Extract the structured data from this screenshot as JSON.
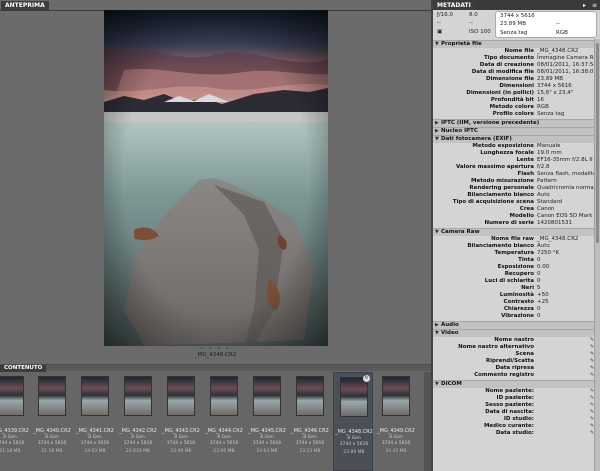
{
  "preview": {
    "tab": "ANTEPRIMA",
    "dots": "• • • •",
    "caption": "_MG_4348.CR2"
  },
  "content": {
    "tab": "CONTENUTO",
    "thumbnails": [
      {
        "name": "_MG_4339.CR2",
        "line2": "8 Gen",
        "line3": "3744 x 5616",
        "size": "21.18 MB",
        "selected": false
      },
      {
        "name": "_MG_4340.CR2",
        "line2": "8 Gen",
        "line3": "3744 x 5616",
        "size": "21.18 MB",
        "selected": false
      },
      {
        "name": "_MG_4341.CR2",
        "line2": "8 Gen",
        "line3": "3744 x 5616",
        "size": "24.03 MB",
        "selected": false
      },
      {
        "name": "_MG_4342.CR2",
        "line2": "8 Gen",
        "line3": "3744 x 5616",
        "size": "24.610 MB",
        "selected": false
      },
      {
        "name": "_MG_4343.CR2",
        "line2": "8 Gen",
        "line3": "3744 x 5616",
        "size": "23.49 MB",
        "selected": false
      },
      {
        "name": "_MG_4344.CR2",
        "line2": "8 Gen",
        "line3": "3744 x 5616",
        "size": "23.60 MB",
        "selected": false
      },
      {
        "name": "_MG_4345.CR2",
        "line2": "8 Gen",
        "line3": "3744 x 5616",
        "size": "24.63 MB",
        "selected": false
      },
      {
        "name": "_MG_4346.CR2",
        "line2": "8 Gen",
        "line3": "3744 x 5616",
        "size": "23.13 MB",
        "selected": false
      },
      {
        "name": "_MG_4348.CR2",
        "line2": "8 Gen",
        "line3": "3744 x 5616",
        "size": "23.89 MB",
        "selected": true
      },
      {
        "name": "_MG_4349.CR2",
        "line2": "8 Gen",
        "line3": "3744 x 5616",
        "size": "24.43 MB",
        "selected": false
      }
    ]
  },
  "metadata": {
    "tab": "METADATI",
    "summary": {
      "aperture": "ƒ/16.0",
      "exposure": "8.0",
      "flash_icon": "--",
      "iso": "ISO 100",
      "ev": "--",
      "dimensions": "3744 x 5616",
      "filesize": "23.89 MB",
      "dpi": "--",
      "tag": "Senza tag",
      "colormode": "RGB"
    },
    "sections": {
      "file_props": "Proprietà file",
      "iptc": "IPTC (IIM, versione precedente)",
      "iptc_core": "Nucleo IPTC",
      "exif": "Dati fotocamera (EXIF)",
      "camera_raw": "Camera Raw",
      "audio": "Audio",
      "video": "Video",
      "dicom": "DICOM"
    },
    "file_rows": [
      {
        "k": "Nome file",
        "v": "_MG_4348.CR2"
      },
      {
        "k": "Tipo documento",
        "v": "Immagine Camera Raw"
      },
      {
        "k": "Data di creazione",
        "v": "08/01/2011, 16:37:58"
      },
      {
        "k": "Data di modifica file",
        "v": "08/01/2011, 16:38:03"
      },
      {
        "k": "Dimensione file",
        "v": "23.89 MB"
      },
      {
        "k": "Dimensioni",
        "v": "3744 x 5616"
      },
      {
        "k": "Dimensioni (in pollici)",
        "v": "15,6\" x 23,4\""
      },
      {
        "k": "Profondità bit",
        "v": "16"
      },
      {
        "k": "Metodo colore",
        "v": "RGB"
      },
      {
        "k": "Profilo colore",
        "v": "Senza tag"
      }
    ],
    "exif_rows": [
      {
        "k": "Metodo esposizione",
        "v": "Manuale"
      },
      {
        "k": "Lunghezza focale",
        "v": "19.0 mm"
      },
      {
        "k": "Lente",
        "v": "EF16-35mm f/2.8L II USM"
      },
      {
        "k": "Valore massimo apertura",
        "v": "f/2.8"
      },
      {
        "k": "Flash",
        "v": "Senza flash, modalità obbligatoria"
      },
      {
        "k": "Metodo misurazione",
        "v": "Pattern"
      },
      {
        "k": "Rendering personale",
        "v": "Quadricromia normale"
      },
      {
        "k": "Bilanciamento bianco",
        "v": "Auto"
      },
      {
        "k": "Tipo di acquisizione scena",
        "v": "Standard"
      },
      {
        "k": "Crea",
        "v": "Canon"
      },
      {
        "k": "Modello",
        "v": "Canon EOS 5D Mark II"
      },
      {
        "k": "Numero di serie",
        "v": "1420801531"
      }
    ],
    "raw_rows": [
      {
        "k": "Nome file raw",
        "v": "_MG_4348.CR2"
      },
      {
        "k": "Bilanciamento bianco",
        "v": "Auto"
      },
      {
        "k": "Temperatura",
        "v": "7250 °K"
      },
      {
        "k": "Tinta",
        "v": "0"
      },
      {
        "k": "Esposizione",
        "v": "0.00"
      },
      {
        "k": "Recupero",
        "v": "0"
      },
      {
        "k": "Luci di schiarita",
        "v": "0"
      },
      {
        "k": "Neri",
        "v": "5"
      },
      {
        "k": "Luminosità",
        "v": "+50"
      },
      {
        "k": "Contrasto",
        "v": "+25"
      },
      {
        "k": "Chiarezza",
        "v": "0"
      },
      {
        "k": "Vibrazione",
        "v": "0"
      }
    ],
    "video_rows": [
      {
        "k": "Nome nastro",
        "v": ""
      },
      {
        "k": "Nome nastro alternativo",
        "v": ""
      },
      {
        "k": "Scena",
        "v": ""
      },
      {
        "k": "Riprendi/Scatta",
        "v": ""
      },
      {
        "k": "Data ripresa",
        "v": ""
      },
      {
        "k": "Commento registro",
        "v": ""
      }
    ],
    "dicom_rows": [
      {
        "k": "Nome paziente:",
        "v": ""
      },
      {
        "k": "ID paziente:",
        "v": ""
      },
      {
        "k": "Sesso paziente:",
        "v": ""
      },
      {
        "k": "Data di nascita:",
        "v": ""
      },
      {
        "k": "ID studio:",
        "v": ""
      },
      {
        "k": "Medico curante:",
        "v": ""
      },
      {
        "k": "Data studio:",
        "v": ""
      }
    ]
  }
}
